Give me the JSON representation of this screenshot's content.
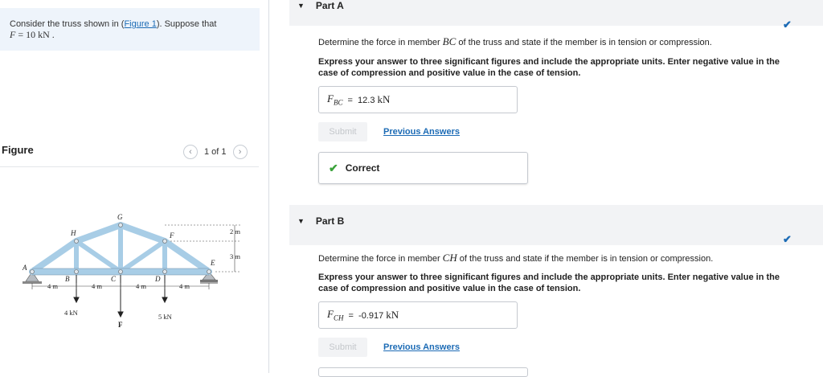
{
  "problem": {
    "prefix": "Consider the truss shown in (",
    "link": "Figure 1",
    "suffix": "). Suppose that",
    "force_var": "F",
    "force_eq": " = 10 ",
    "force_unit": "kN",
    "force_end": " ."
  },
  "figure": {
    "title": "Figure",
    "page": "1 of 1",
    "labels": {
      "A": "A",
      "B": "B",
      "C": "C",
      "D": "D",
      "E": "E",
      "F_top": "F",
      "G": "G",
      "H": "H",
      "F_bottom": "F",
      "load1": "4 kN",
      "load2": "5 kN",
      "span1": "4 m",
      "span2": "4 m",
      "span3": "4 m",
      "span4": "4 m",
      "h1": "2 m",
      "h2": "3 m"
    }
  },
  "part_a": {
    "title": "Part A",
    "question": "Determine the force in member ",
    "member": "BC",
    "question_end": " of the truss and state if the member is in tension or compression.",
    "instructions": "Express your answer to three significant figures and include the appropriate units. Enter negative value in the case of compression and positive value in the case of tension.",
    "answer_label": "F",
    "answer_sub": "BC",
    "answer_eq": "=",
    "answer_value": "12.3",
    "answer_unit": "kN",
    "submit": "Submit",
    "previous": "Previous Answers",
    "feedback": "Correct"
  },
  "part_b": {
    "title": "Part B",
    "question": "Determine the force in member ",
    "member": "CH",
    "question_end": " of the truss and state if the member is in tension or compression.",
    "instructions": "Express your answer to three significant figures and include the appropriate units. Enter negative value in the case of compression and positive value in the case of tension.",
    "answer_label": "F",
    "answer_sub": "CH",
    "answer_eq": "=",
    "answer_value": "-0.917",
    "answer_unit": "kN",
    "submit": "Submit",
    "previous": "Previous Answers"
  },
  "colors": {
    "accent": "#1c6bb5",
    "truss": "#a8cde6",
    "check_green": "#3aa23a"
  },
  "icons": {
    "collapse": "triangle-down-icon",
    "check": "checkmark-icon",
    "prev_page": "chevron-left-icon",
    "next_page": "chevron-right-icon"
  }
}
